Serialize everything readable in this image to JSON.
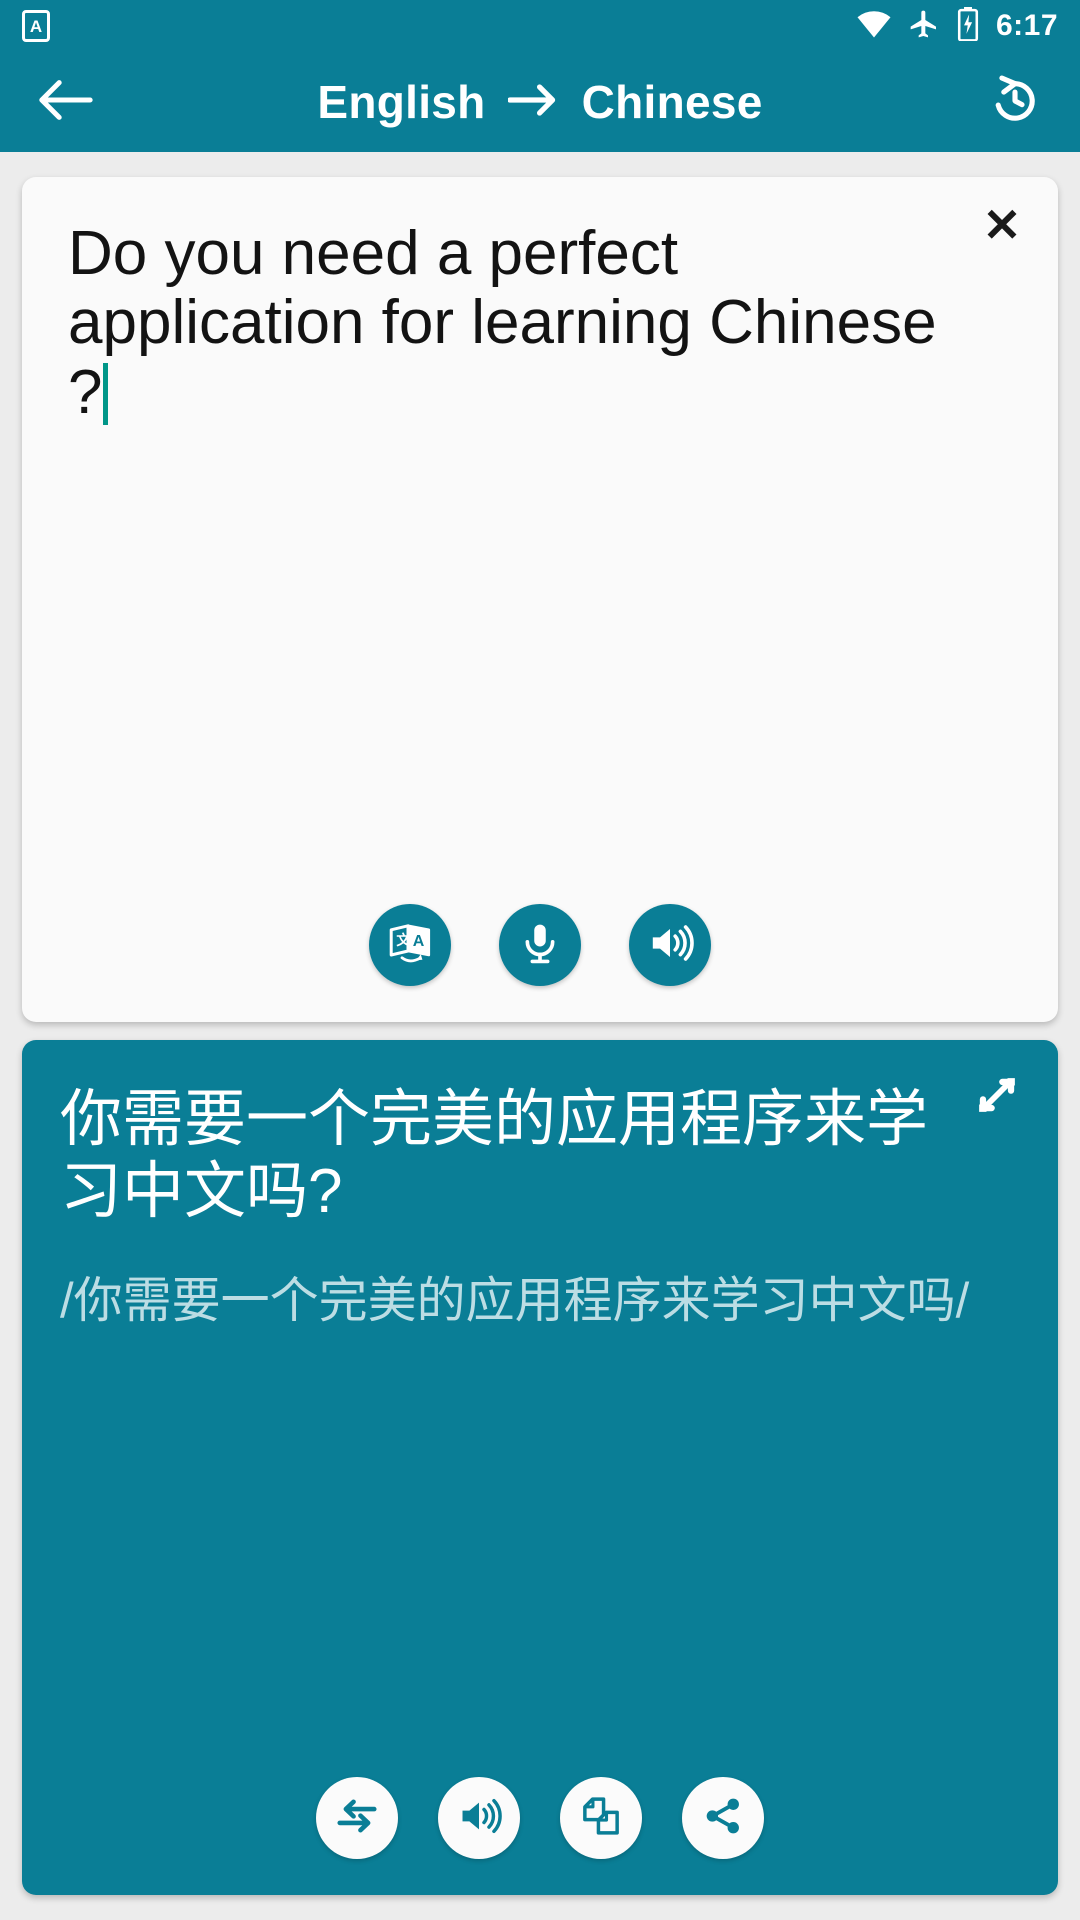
{
  "theme": {
    "accent": "#0a7e96",
    "page_bg": "#ececec",
    "card_bg": "#fafafa",
    "caret": "#009688",
    "translit_color": "#bcdde4"
  },
  "status_bar": {
    "app_icon": "app-badge-icon",
    "wifi": "wifi-icon",
    "airplane": "airplane-mode-icon",
    "battery": "battery-charging-icon",
    "time": "6:17"
  },
  "app_bar": {
    "back": "back-arrow-icon",
    "source_language": "English",
    "arrow": "→",
    "target_language": "Chinese",
    "history": "history-icon"
  },
  "source_card": {
    "close_label": "✕",
    "text": "Do you need a perfect application for learning Chinese ?",
    "has_caret": true,
    "actions": [
      {
        "name": "translate-button",
        "icon": "translate-icon"
      },
      {
        "name": "microphone-button",
        "icon": "microphone-icon"
      },
      {
        "name": "speak-source-button",
        "icon": "speaker-icon"
      }
    ]
  },
  "result_card": {
    "expand": "expand-fullscreen-icon",
    "translation": "你需要一个完美的应用程序来学习中文吗?",
    "transliteration": "/你需要一个完美的应用程序来学习中文吗/",
    "actions": [
      {
        "name": "swap-languages-button",
        "icon": "swap-arrows-icon"
      },
      {
        "name": "speak-translation-button",
        "icon": "speaker-icon"
      },
      {
        "name": "copy-button",
        "icon": "copy-icon"
      },
      {
        "name": "share-button",
        "icon": "share-icon"
      }
    ]
  }
}
